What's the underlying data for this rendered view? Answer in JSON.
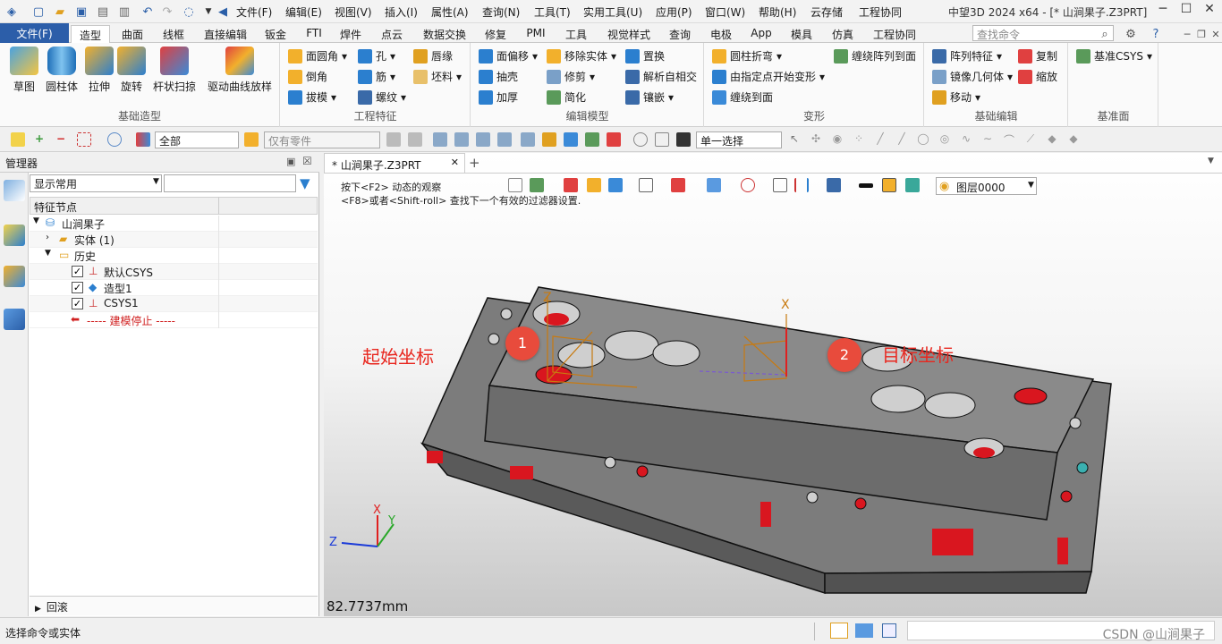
{
  "titlebar": {
    "menus": [
      "文件(F)",
      "编辑(E)",
      "视图(V)",
      "插入(I)",
      "属性(A)",
      "查询(N)",
      "工具(T)",
      "实用工具(U)",
      "应用(P)",
      "窗口(W)",
      "帮助(H)",
      "云存储",
      "工程协同"
    ],
    "title": "中望3D 2024 x64 - [* 山涧果子.Z3PRT]"
  },
  "tabbar": {
    "file_tab": "文件(F)",
    "tabs": [
      "造型",
      "曲面",
      "线框",
      "直接编辑",
      "钣金",
      "FTI",
      "焊件",
      "点云",
      "数据交换",
      "修复",
      "PMI",
      "工具",
      "视觉样式",
      "查询",
      "电极",
      "App",
      "模具",
      "仿真",
      "工程协同"
    ],
    "search_placeholder": "查找命令"
  },
  "ribbon": {
    "groups": [
      {
        "label": "基础造型",
        "buttons": [
          "草图",
          "圆柱体",
          "拉伸",
          "旋转",
          "杆状扫掠",
          "驱动曲线放样"
        ]
      },
      {
        "label": "工程特征",
        "buttons": [
          "面圆角",
          "孔",
          "唇缘",
          "倒角",
          "筋",
          "坯料",
          "拔模",
          "螺纹"
        ]
      },
      {
        "label": "编辑模型",
        "buttons": [
          "面偏移",
          "移除实体",
          "置换",
          "抽壳",
          "修剪",
          "解析自相交",
          "加厚",
          "简化",
          "镶嵌"
        ]
      },
      {
        "label": "变形",
        "buttons": [
          "圆柱折弯",
          "缠绕阵列到面",
          "由指定点开始变形",
          "缠绕到面"
        ]
      },
      {
        "label": "基础编辑",
        "buttons": [
          "阵列特征",
          "复制",
          "镜像几何体",
          "缩放",
          "移动"
        ]
      },
      {
        "label": "基准面",
        "buttons": [
          "基准CSYS"
        ]
      }
    ]
  },
  "toolbar2": {
    "filter_value": "全部",
    "part_placeholder": "仅有零件",
    "select_mode": "单一选择"
  },
  "manager": {
    "title": "管理器",
    "display_combo": "显示常用",
    "tree_header": "特征节点",
    "tree": [
      {
        "label": "山涧果子",
        "level": 0
      },
      {
        "label": "实体 (1)",
        "level": 1
      },
      {
        "label": "历史",
        "level": 1
      },
      {
        "label": "默认CSYS",
        "level": 2
      },
      {
        "label": "造型1",
        "level": 2
      },
      {
        "label": "CSYS1",
        "level": 2
      },
      {
        "label": "----- 建模停止 -----",
        "level": 2
      }
    ],
    "return_label": "回滚"
  },
  "viewport": {
    "doc_tab": "* 山涧果子.Z3PRT",
    "hint_line1": "按下<F2> 动态的观察",
    "hint_line2": "<F8>或者<Shift-roll> 查找下一个有效的过滤器设置.",
    "layer": "图层0000",
    "scale": "82.7737mm",
    "start_label": "起始坐标",
    "target_label": "目标坐标",
    "badge1": "1",
    "badge2": "2",
    "axis_x": "X",
    "axis_y": "Y",
    "axis_z": "Z"
  },
  "statusbar": {
    "text": "选择命令或实体",
    "watermark": "CSDN @山涧果子"
  },
  "colors": {
    "accent": "#2c5ea9",
    "annotation": "#e84b3c",
    "hole": "#d9161f"
  }
}
